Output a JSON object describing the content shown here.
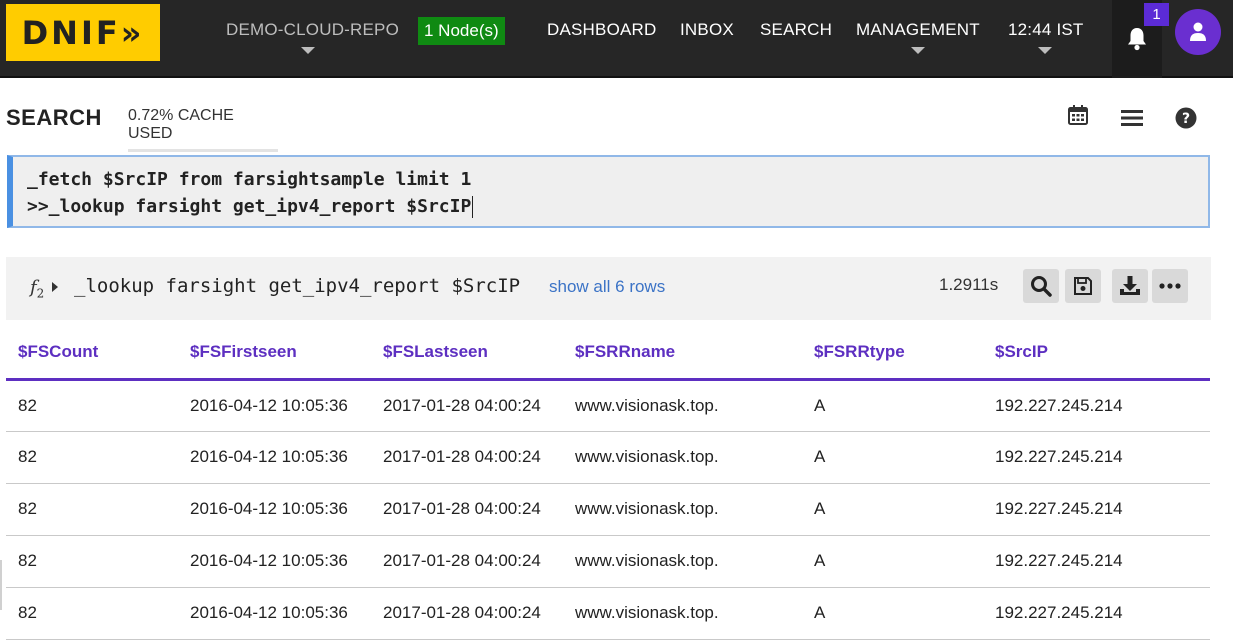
{
  "brand": {
    "logo_text": "DNIF»",
    "accent": "#ffcc00"
  },
  "topbar": {
    "repo": "DEMO-CLOUD-REPO",
    "nodes": "1 Node(s)",
    "nav": {
      "dashboard": "DASHBOARD",
      "inbox": "INBOX",
      "search": "SEARCH",
      "management": "MANAGEMENT"
    },
    "time": "12:44 IST",
    "notifications_count": "1",
    "icons": {
      "notifications": "bell-icon",
      "user": "user-icon"
    }
  },
  "search": {
    "title": "SEARCH",
    "cache": "0.72% CACHE USED",
    "toolbar_icons": [
      "calendar-icon",
      "menu-icon",
      "help-icon"
    ],
    "query_line1": "_fetch $SrcIP from farsightsample limit 1",
    "query_line2": ">>_lookup farsight get_ipv4_report $SrcIP"
  },
  "result": {
    "fn_symbol": "f",
    "fn_index": "2",
    "query": "_lookup farsight get_ipv4_report $SrcIP",
    "show_all": "show all 6 rows",
    "timing": "1.2911s",
    "actions": [
      "search-icon",
      "save-icon",
      "download-icon",
      "more-icon"
    ]
  },
  "table": {
    "columns": [
      "$FSCount",
      "$FSFirstseen",
      "$FSLastseen",
      "$FSRRname",
      "$FSRRtype",
      "$SrcIP"
    ],
    "rows": [
      [
        "82",
        "2016-04-12 10:05:36",
        "2017-01-28 04:00:24",
        "www.visionask.top.",
        "A",
        "192.227.245.214"
      ],
      [
        "82",
        "2016-04-12 10:05:36",
        "2017-01-28 04:00:24",
        "www.visionask.top.",
        "A",
        "192.227.245.214"
      ],
      [
        "82",
        "2016-04-12 10:05:36",
        "2017-01-28 04:00:24",
        "www.visionask.top.",
        "A",
        "192.227.245.214"
      ],
      [
        "82",
        "2016-04-12 10:05:36",
        "2017-01-28 04:00:24",
        "www.visionask.top.",
        "A",
        "192.227.245.214"
      ],
      [
        "82",
        "2016-04-12 10:05:36",
        "2017-01-28 04:00:24",
        "www.visionask.top.",
        "A",
        "192.227.245.214"
      ]
    ]
  },
  "colors": {
    "header_accent": "#5d2fc1",
    "link": "#3b73c6",
    "node_badge": "#0f8a12"
  }
}
